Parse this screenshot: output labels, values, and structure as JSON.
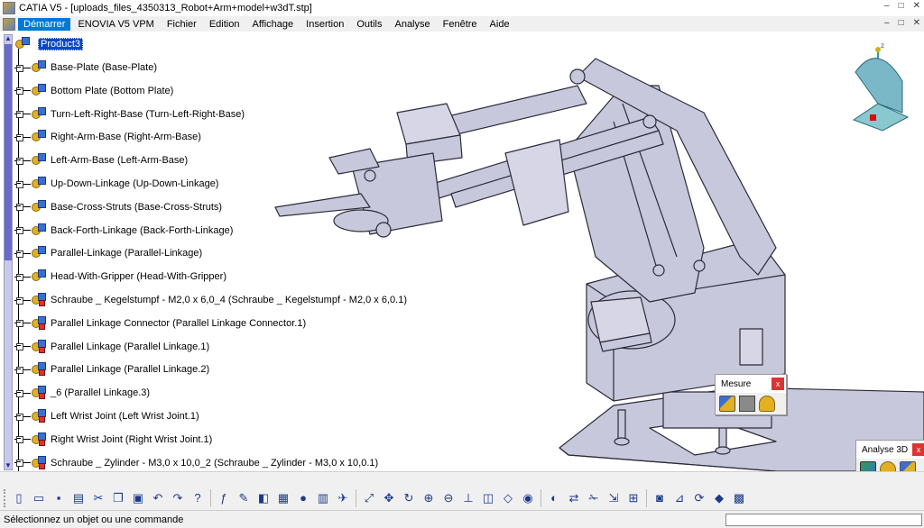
{
  "window": {
    "title": "CATIA V5 - [uploads_files_4350313_Robot+Arm+model+w3dT.stp]",
    "controls": [
      "–",
      "□",
      "✕"
    ]
  },
  "menubar": {
    "items": [
      "Démarrer",
      "ENOVIA V5 VPM",
      "Fichier",
      "Edition",
      "Affichage",
      "Insertion",
      "Outils",
      "Analyse",
      "Fenêtre",
      "Aide"
    ],
    "right_controls": [
      "–",
      "□",
      "✕"
    ]
  },
  "tree": {
    "root": "Product3",
    "nodes": [
      {
        "label": "Base-Plate (Base-Plate)",
        "icon": "part-icon"
      },
      {
        "label": "Bottom Plate (Bottom Plate)",
        "icon": "part-icon"
      },
      {
        "label": "Turn-Left-Right-Base (Turn-Left-Right-Base)",
        "icon": "part-icon"
      },
      {
        "label": "Right-Arm-Base (Right-Arm-Base)",
        "icon": "part-icon"
      },
      {
        "label": "Left-Arm-Base (Left-Arm-Base)",
        "icon": "part-icon"
      },
      {
        "label": "Up-Down-Linkage (Up-Down-Linkage)",
        "icon": "part-icon"
      },
      {
        "label": "Base-Cross-Struts (Base-Cross-Struts)",
        "icon": "part-icon"
      },
      {
        "label": "Back-Forth-Linkage (Back-Forth-Linkage)",
        "icon": "part-icon"
      },
      {
        "label": "Parallel-Linkage (Parallel-Linkage)",
        "icon": "part-icon"
      },
      {
        "label": "Head-With-Gripper (Head-With-Gripper)",
        "icon": "part-icon"
      },
      {
        "label": "Schraube _ Kegelstumpf - M2,0 x 6,0_4 (Schraube _ Kegelstumpf - M2,0 x 6,0.1)",
        "icon": "product-icon"
      },
      {
        "label": "Parallel Linkage Connector (Parallel Linkage Connector.1)",
        "icon": "product-icon"
      },
      {
        "label": "Parallel Linkage (Parallel Linkage.1)",
        "icon": "product-icon"
      },
      {
        "label": "Parallel Linkage (Parallel Linkage.2)",
        "icon": "product-icon"
      },
      {
        "label": "_6 (Parallel Linkage.3)",
        "icon": "product-icon"
      },
      {
        "label": "Left Wrist Joint (Left Wrist Joint.1)",
        "icon": "product-icon"
      },
      {
        "label": "Right Wrist Joint (Right Wrist Joint.1)",
        "icon": "product-icon"
      },
      {
        "label": "Schraube _ Zylinder - M3,0 x 10,0_2 (Schraube _ Zylinder - M3,0 x 10,0.1)",
        "icon": "product-icon"
      }
    ]
  },
  "compass": {
    "axis_label": "z"
  },
  "mesure_toolbar": {
    "title": "Mesure",
    "close": "x"
  },
  "analyse_toolbar": {
    "title": "Analyse 3D",
    "close": "x"
  },
  "status": {
    "message": "Sélectionnez un objet ou une commande",
    "command_value": ""
  },
  "toolbar_icons": [
    "new-file-icon",
    "open-folder-icon",
    "save-icon",
    "print-icon",
    "cut-icon",
    "copy-icon",
    "paste-icon",
    "undo-icon",
    "redo-icon",
    "whats-this-icon",
    "formula-icon",
    "comment-icon",
    "knowledge-icon",
    "catalog-icon",
    "lock-icon",
    "table-icon",
    "fly-mode-icon",
    "fit-all-icon",
    "pan-icon",
    "rotate-icon",
    "zoom-in-icon",
    "zoom-out-icon",
    "normal-view-icon",
    "multi-view-icon",
    "iso-view-icon",
    "shading-icon",
    "hide-show-icon",
    "swap-icon",
    "scissors-icon",
    "move-icon",
    "ungroup-icon",
    "camera-icon",
    "measure-icon",
    "refresh-icon",
    "eraser-icon",
    "grid-icon"
  ],
  "colors": {
    "accent": "#0078d7",
    "selection": "#0a48c2",
    "part": "#c8c8dc",
    "part_stroke": "#2b2b3a"
  }
}
